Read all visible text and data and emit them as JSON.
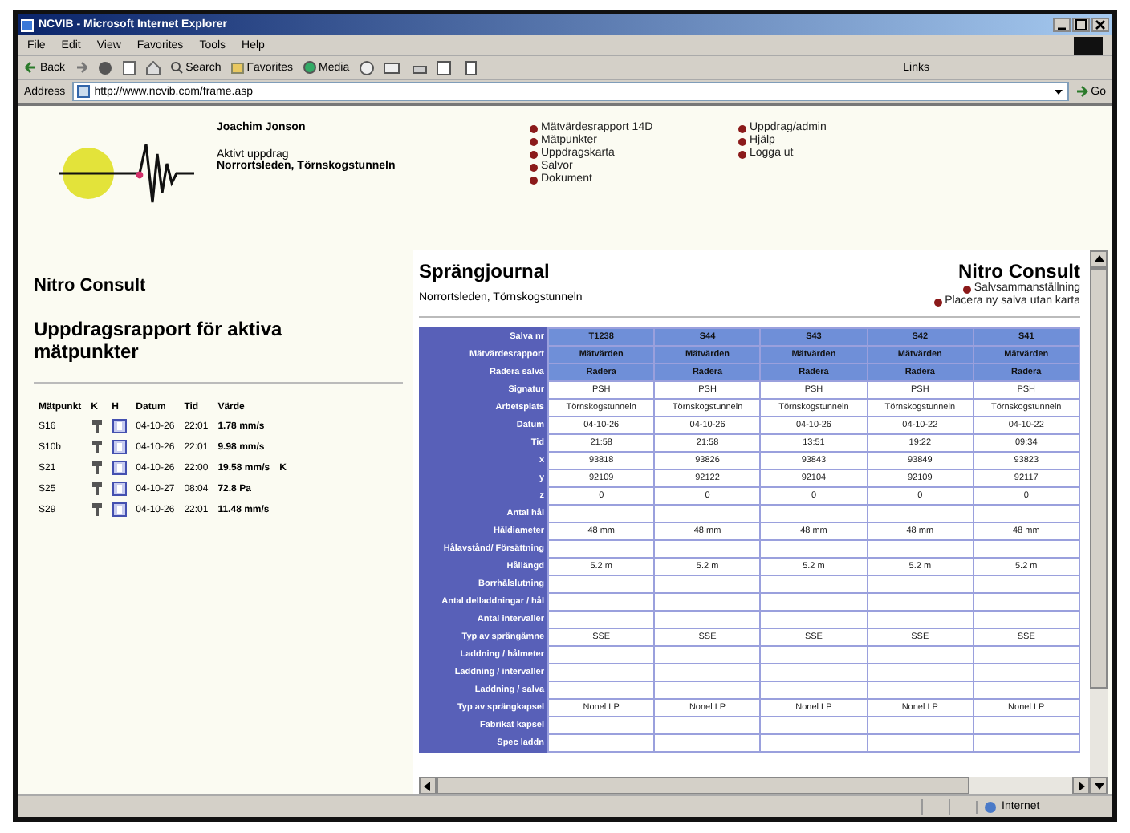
{
  "window": {
    "title": "NCVIB - Microsoft Internet Explorer"
  },
  "menu": [
    "File",
    "Edit",
    "View",
    "Favorites",
    "Tools",
    "Help"
  ],
  "toolbar": {
    "back": "Back",
    "search": "Search",
    "favorites": "Favorites",
    "media": "Media",
    "links": "Links"
  },
  "address": {
    "label": "Address",
    "value": "http://www.ncvib.com/frame.asp",
    "go": "Go"
  },
  "header": {
    "user": "Joachim Jonson",
    "active_label": "Aktivt uppdrag",
    "active_value": "Norrortsleden, Törnskogstunneln",
    "links_1": [
      "Mätvärdesrapport  14D",
      "Mätpunkter",
      "Uppdragskarta",
      "Salvor",
      "Dokument"
    ],
    "links_2": [
      "Uppdrag/admin",
      "Hjälp",
      "Logga ut"
    ]
  },
  "left": {
    "company": "Nitro Consult",
    "title": "Uppdragsrapport för aktiva mätpunkter",
    "columns": [
      "Mätpunkt",
      "K",
      "H",
      "Datum",
      "Tid",
      "Värde"
    ],
    "rows": [
      {
        "point": "S16",
        "date": "04-10-26",
        "time": "22:01",
        "value": "1.78 mm/s"
      },
      {
        "point": "S10b",
        "date": "04-10-26",
        "time": "22:01",
        "value": "9.98 mm/s"
      },
      {
        "point": "S21",
        "date": "04-10-26",
        "time": "22:00",
        "value": "19.58 mm/s",
        "flag": "K"
      },
      {
        "point": "S25",
        "date": "04-10-27",
        "time": "08:04",
        "value": "72.8 Pa"
      },
      {
        "point": "S29",
        "date": "04-10-26",
        "time": "22:01",
        "value": "11.48 mm/s"
      }
    ]
  },
  "journal": {
    "title": "Sprängjournal",
    "subtitle": "Norrortsleden, Törnskogstunneln",
    "company": "Nitro Consult",
    "links": [
      "Salvsammanställning",
      "Placera ny salva utan karta"
    ],
    "rows": [
      {
        "label": "Salva nr",
        "kind": "head",
        "cells": [
          "T1238",
          "S44",
          "S43",
          "S42",
          "S41"
        ]
      },
      {
        "label": "Mätvärdesrapport",
        "kind": "head",
        "cells": [
          "Mätvärden",
          "Mätvärden",
          "Mätvärden",
          "Mätvärden",
          "Mätvärden"
        ]
      },
      {
        "label": "Radera salva",
        "kind": "head",
        "cells": [
          "Radera",
          "Radera",
          "Radera",
          "Radera",
          "Radera"
        ]
      },
      {
        "label": "Signatur",
        "kind": "data",
        "cells": [
          "PSH",
          "PSH",
          "PSH",
          "PSH",
          "PSH"
        ]
      },
      {
        "label": "Arbetsplats",
        "kind": "data",
        "cells": [
          "Törnskogstunneln",
          "Törnskogstunneln",
          "Törnskogstunneln",
          "Törnskogstunneln",
          "Törnskogstunneln"
        ]
      },
      {
        "label": "Datum",
        "kind": "data",
        "cells": [
          "04-10-26",
          "04-10-26",
          "04-10-26",
          "04-10-22",
          "04-10-22"
        ]
      },
      {
        "label": "Tid",
        "kind": "data",
        "cells": [
          "21:58",
          "21:58",
          "13:51",
          "19:22",
          "09:34"
        ]
      },
      {
        "label": "x",
        "kind": "data",
        "cells": [
          "93818",
          "93826",
          "93843",
          "93849",
          "93823"
        ]
      },
      {
        "label": "y",
        "kind": "data",
        "cells": [
          "92109",
          "92122",
          "92104",
          "92109",
          "92117"
        ]
      },
      {
        "label": "z",
        "kind": "data",
        "cells": [
          "0",
          "0",
          "0",
          "0",
          "0"
        ]
      },
      {
        "label": "Antal hål",
        "kind": "data",
        "cells": []
      },
      {
        "label": "Håldiameter",
        "kind": "data",
        "cells": [
          "48 mm",
          "48 mm",
          "48 mm",
          "48 mm",
          "48 mm"
        ]
      },
      {
        "label": "Hålavstånd/ Försättning",
        "kind": "data",
        "cells": []
      },
      {
        "label": "Hållängd",
        "kind": "data",
        "cells": [
          "5.2 m",
          "5.2 m",
          "5.2 m",
          "5.2 m",
          "5.2 m"
        ]
      },
      {
        "label": "Borrhålslutning",
        "kind": "data",
        "cells": []
      },
      {
        "label": "Antal delladdningar / hål",
        "kind": "data",
        "cells": []
      },
      {
        "label": "Antal intervaller",
        "kind": "data",
        "cells": []
      },
      {
        "label": "Typ av sprängämne",
        "kind": "data",
        "cells": [
          "SSE",
          "SSE",
          "SSE",
          "SSE",
          "SSE"
        ]
      },
      {
        "label": "Laddning / hålmeter",
        "kind": "data",
        "cells": []
      },
      {
        "label": "Laddning / intervaller",
        "kind": "data",
        "cells": []
      },
      {
        "label": "Laddning / salva",
        "kind": "data",
        "cells": []
      },
      {
        "label": "Typ av sprängkapsel",
        "kind": "data",
        "cells": [
          "Nonel LP",
          "Nonel LP",
          "Nonel LP",
          "Nonel LP",
          "Nonel LP"
        ]
      },
      {
        "label": "Fabrikat kapsel",
        "kind": "data",
        "cells": []
      },
      {
        "label": "Spec laddn",
        "kind": "data",
        "cells": []
      }
    ]
  },
  "status_bar": {
    "zone": "Internet"
  }
}
